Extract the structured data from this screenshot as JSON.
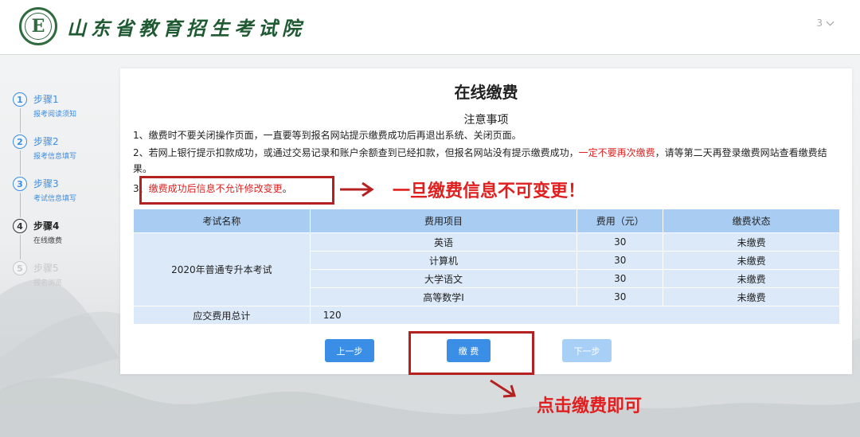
{
  "header": {
    "site_title": "山东省教育招生考试院",
    "logo_letter": "E",
    "user_label": "3"
  },
  "steps": [
    {
      "num": "1",
      "title": "步骤1",
      "sub": "报考阅读须知",
      "state": "done"
    },
    {
      "num": "2",
      "title": "步骤2",
      "sub": "报考信息填写",
      "state": "done"
    },
    {
      "num": "3",
      "title": "步骤3",
      "sub": "考试信息填写",
      "state": "done"
    },
    {
      "num": "4",
      "title": "步骤4",
      "sub": "在线缴费",
      "state": "active"
    },
    {
      "num": "5",
      "title": "步骤5",
      "sub": "报名浏览",
      "state": "todo"
    }
  ],
  "page": {
    "title": "在线缴费",
    "notice_title": "注意事项",
    "notice1": "1、缴费时不要关闭操作页面，一直要等到报名网站提示缴费成功后再退出系统、关闭页面。",
    "notice2_a": "2、若网上银行提示扣款成功，或通过交易记录和账户余额查到已经扣款，但报名网站没有提示缴费成功，",
    "notice2_red": "一定不要再次缴费",
    "notice2_b": "，请等第二天再登录缴费网站查看缴费结果。",
    "notice3_prefix": "3、",
    "notice3_red": "缴费成功后信息不允许修改变更",
    "notice3_suffix": "。"
  },
  "table": {
    "headers": [
      "考试名称",
      "费用项目",
      "费用（元）",
      "缴费状态"
    ],
    "exam_name": "2020年普通专升本考试",
    "rows": [
      {
        "item": "英语",
        "fee": "30",
        "status": "未缴费"
      },
      {
        "item": "计算机",
        "fee": "30",
        "status": "未缴费"
      },
      {
        "item": "大学语文",
        "fee": "30",
        "status": "未缴费"
      },
      {
        "item": "高等数学Ⅰ",
        "fee": "30",
        "status": "未缴费"
      }
    ],
    "total_label": "应交费用总计",
    "total_value": "120"
  },
  "buttons": {
    "prev": "上一步",
    "pay": "缴 费",
    "next": "下一步"
  },
  "annotations": {
    "note1": "一旦缴费信息不可变更！",
    "note2": "点击缴费即可"
  },
  "colors": {
    "accent": "#3a8ee6",
    "annotation_red": "#e02020",
    "brand_green": "#1f5a33"
  }
}
